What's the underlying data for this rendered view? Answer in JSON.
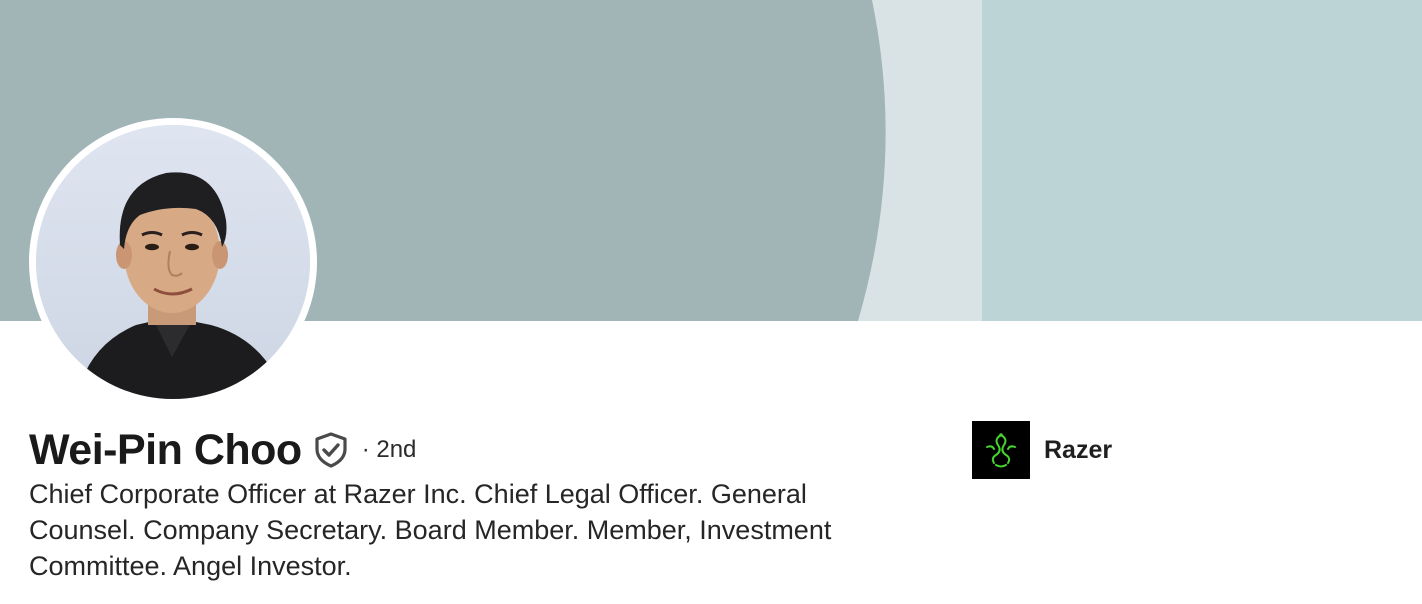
{
  "profile": {
    "name": "Wei-Pin Choo",
    "connection_degree": "· 2nd",
    "headline": "Chief Corporate Officer at Razer Inc. Chief Legal Officer. General Counsel. Company Secretary. Board Member. Member, Investment Committee. Angel Investor.",
    "verified_icon": "verified-shield-icon"
  },
  "company": {
    "name": "Razer",
    "logo_icon": "razer-snake-logo"
  },
  "colors": {
    "cover_dark": "#a1b5b7",
    "cover_light_strip": "#d9e3e5",
    "cover_right": "#bdd4d7",
    "razer_green": "#44d62c"
  }
}
